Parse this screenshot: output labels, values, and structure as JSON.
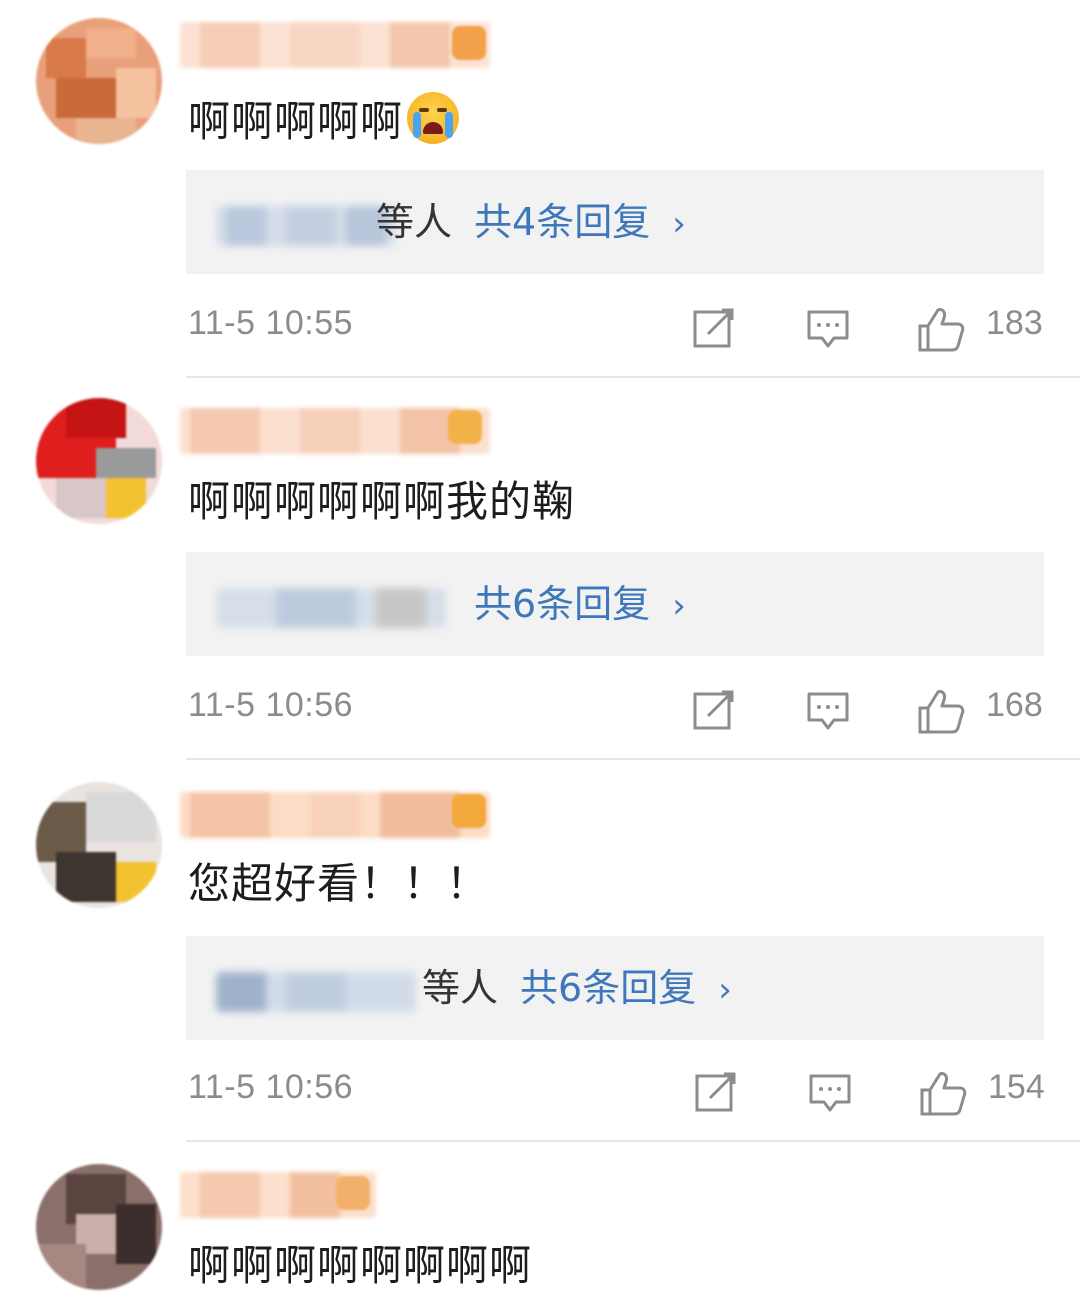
{
  "comments": [
    {
      "text": "啊啊啊啊啊",
      "emoji": "crying-face-emoji",
      "reply_suffix": "等人",
      "reply_count": "共4条回复",
      "chevron": "›",
      "time": "11-5 10:55",
      "likes": "183"
    },
    {
      "text": "啊啊啊啊啊啊我的鞠",
      "reply_suffix": "",
      "reply_count": "共6条回复",
      "chevron": "›",
      "time": "11-5 10:56",
      "likes": "168"
    },
    {
      "text": "您超好看！！！",
      "reply_suffix": "等人",
      "reply_count": "共6条回复",
      "chevron": "›",
      "time": "11-5 10:56",
      "likes": "154"
    },
    {
      "text": "啊啊啊啊啊啊啊啊"
    }
  ],
  "colors": {
    "reply_link": "#3f78ba",
    "meta_gray": "#8c8c8c",
    "reply_bg": "#f2f2f2"
  },
  "icons": [
    "share-icon",
    "comment-icon",
    "like-icon"
  ]
}
